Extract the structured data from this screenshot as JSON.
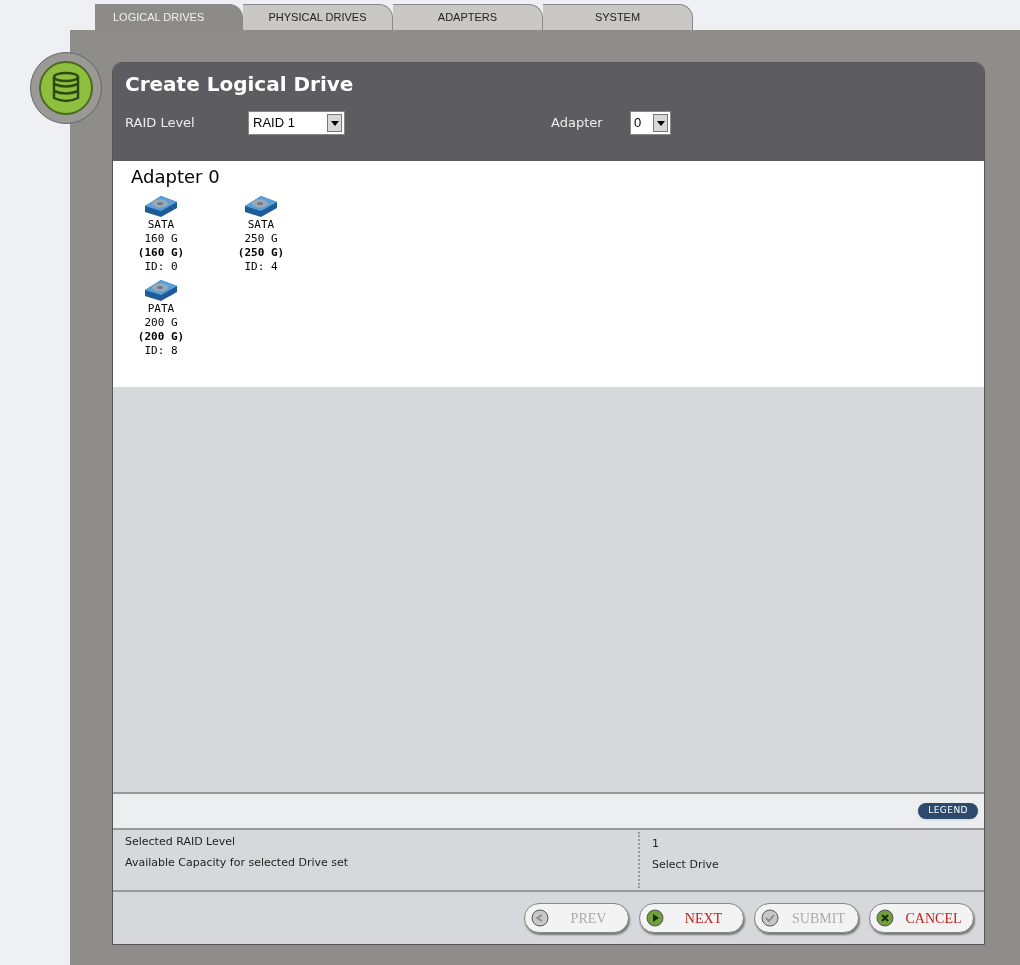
{
  "tabs": [
    {
      "label": "LOGICAL DRIVES",
      "selected": true
    },
    {
      "label": "PHYSICAL DRIVES",
      "selected": false
    },
    {
      "label": "ADAPTERS",
      "selected": false
    },
    {
      "label": "SYSTEM",
      "selected": false
    }
  ],
  "title": "Create Logical Drive",
  "raid_level": {
    "label": "RAID Level",
    "value": "RAID 1"
  },
  "adapter": {
    "label": "Adapter",
    "value": "0"
  },
  "adapter_heading": "Adapter 0",
  "drives": [
    {
      "type": "SATA",
      "size": "160 G",
      "capacity": "(160 G)",
      "id": "ID: 0"
    },
    {
      "type": "SATA",
      "size": "250 G",
      "capacity": "(250 G)",
      "id": "ID: 4"
    },
    {
      "type": "PATA",
      "size": "200 G",
      "capacity": "(200 G)",
      "id": "ID: 8"
    }
  ],
  "legend_button": "LEGEND",
  "info": [
    {
      "label": "Selected RAID Level",
      "value": "1"
    },
    {
      "label": "Available Capacity for selected Drive set",
      "value": "Select Drive"
    }
  ],
  "buttons": [
    {
      "label": "PREV",
      "kind": "prev",
      "disabled": true
    },
    {
      "label": "NEXT",
      "kind": "next",
      "disabled": false
    },
    {
      "label": "SUBMIT",
      "kind": "submit",
      "disabled": true
    },
    {
      "label": "CANCEL",
      "kind": "cancel",
      "disabled": false
    }
  ]
}
